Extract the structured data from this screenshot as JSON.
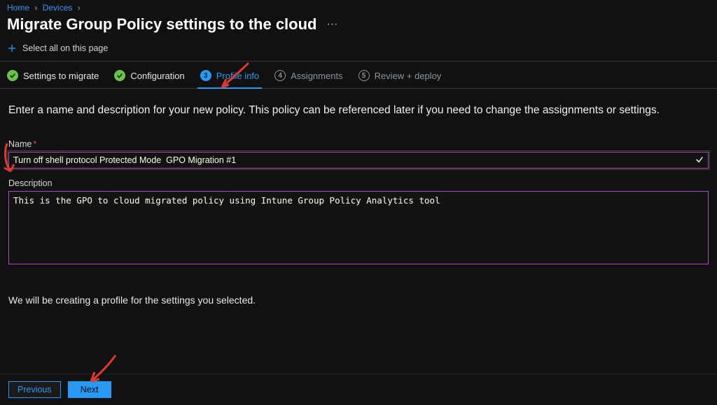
{
  "breadcrumb": {
    "home": "Home",
    "devices": "Devices"
  },
  "page": {
    "title": "Migrate Group Policy settings to the cloud",
    "more": "···"
  },
  "toolbar": {
    "select_all": "Select all on this page"
  },
  "steps": {
    "s1": {
      "label": "Settings to migrate"
    },
    "s2": {
      "label": "Configuration"
    },
    "s3": {
      "num": "3",
      "label": "Profile info"
    },
    "s4": {
      "num": "4",
      "label": "Assignments"
    },
    "s5": {
      "num": "5",
      "label": "Review + deploy"
    }
  },
  "intro": "Enter a name and description for your new policy. This policy can be referenced later if you need to change the assignments or settings.",
  "form": {
    "name_label": "Name",
    "name_value": "Turn off shell protocol Protected Mode  GPO Migration #1",
    "desc_label": "Description",
    "desc_value": "This is the GPO to cloud migrated policy using Intune Group Policy Analytics tool"
  },
  "note": "We will be creating a profile for the settings you selected.",
  "buttons": {
    "previous": "Previous",
    "next": "Next"
  },
  "colors": {
    "accent": "#2899f5",
    "input_border": "#a64cc9",
    "success": "#6cc24a",
    "arrow": "#e03a2f"
  }
}
